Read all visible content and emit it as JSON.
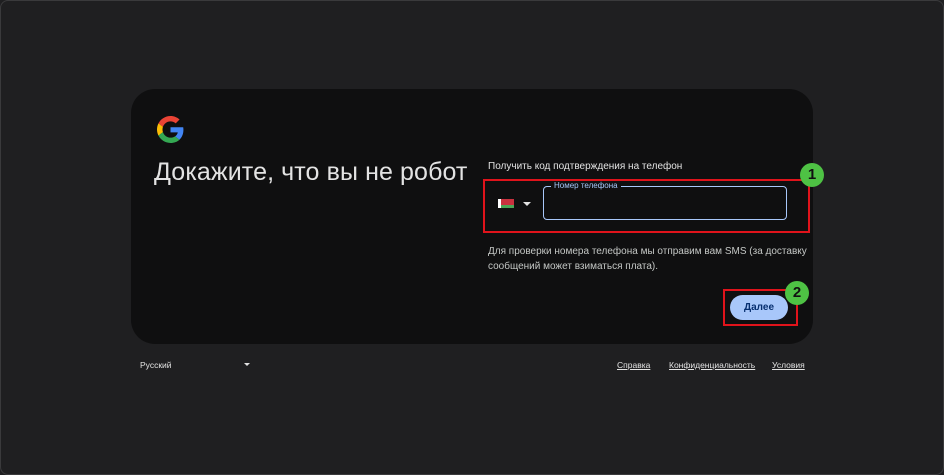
{
  "page": {
    "heading": "Докажите, что вы не робот",
    "logo": "google-g-logo"
  },
  "phone_section": {
    "label": "Получить код подтверждения на телефон",
    "country_flag": "belarus-flag",
    "phone_field_label": "Номер телефона",
    "phone_value": "",
    "hint": "Для проверки номера телефона мы отправим вам SMS (за доставку сообщений может взиматься плата)."
  },
  "actions": {
    "next_label": "Далее"
  },
  "annotations": {
    "badge_1": "1",
    "badge_2": "2"
  },
  "footer": {
    "language": "Русский",
    "help": "Справка",
    "privacy": "Конфиденциальность",
    "terms": "Условия"
  },
  "colors": {
    "background": "#1f1f21",
    "card": "#0f0f10",
    "accent": "#a8c7fa",
    "highlight": "#e0131b",
    "badge": "#4ec244"
  }
}
